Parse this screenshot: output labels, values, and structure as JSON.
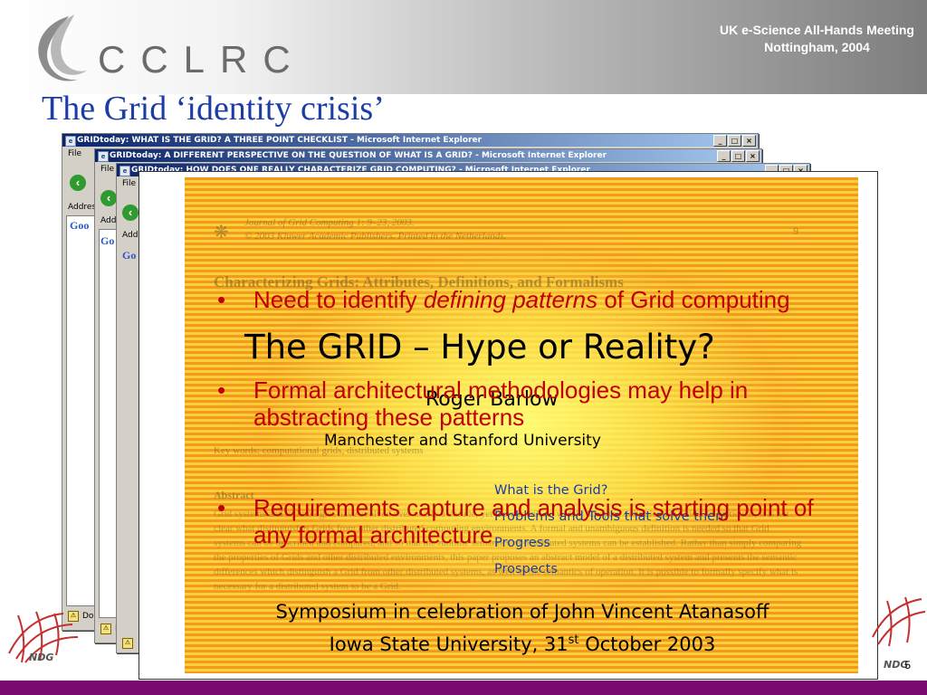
{
  "header": {
    "logo_text": "CCLRC",
    "meeting_line1": "UK e-Science All-Hands Meeting",
    "meeting_line2": "Nottingham, 2004"
  },
  "slide": {
    "title": "The Grid ‘identity crisis’",
    "page_number": "5"
  },
  "ie_windows": [
    {
      "title": "GRIDtoday: WHAT IS THE GRID? A THREE POINT CHECKLIST - Microsoft Internet Explorer",
      "menu": "File",
      "addr": "Address",
      "google": "Goo",
      "status": "Do"
    },
    {
      "title": "GRIDtoday: A DIFFERENT PERSPECTIVE ON THE QUESTION OF WHAT IS A GRID? - Microsoft Internet Explorer",
      "menu": "File",
      "addr": "Address",
      "google": "Go",
      "status": "D"
    },
    {
      "title": "GRIDtoday: HOW DOES ONE REALLY CHARACTERIZE GRID COMPUTING? - Microsoft Internet Explorer",
      "menu": "File",
      "addr": "Address",
      "google": "Go",
      "status": ""
    }
  ],
  "window_buttons": [
    "_",
    "□",
    "×"
  ],
  "paper": {
    "journal": "Journal of Grid Computing 1: 9–23, 2003.",
    "copyright": "© 2003 Kluwer Academic Publishers.  Printed in the Netherlands.",
    "page": "9",
    "heading": "Characterizing Grids: Attributes, Definitions, and Formalisms",
    "abstract_label": "Abstract",
    "keywords": "Key words: computational grids, distributed systems",
    "body": "Grid systems and technologies have evolved over nearly a decade, yet there is still no widely accepted definition for Grids. In particular, it is not clear what distinguishes Grids from other distributed computing environments. A formal and unambiguous definition is needed so that Grid systems can be described and compared, and so that the runtime semantics of distributed systems can be established. Rather than simply comparing the properties of Grids and other distributed environments, this paper proposes an abstract model of a distributed system and presents the semantic differences which distinguish a Grid from other distributed systems, as well as the semantics of operation. It is possible to formally specify what is necessary for a distributed system to be a Grid."
  },
  "talk": {
    "title": "The GRID – Hype or Reality?",
    "author": "Roger Barlow",
    "affiliation": "Manchester and Stanford University",
    "outline": [
      "What is the Grid?",
      "Problems and Tools that solve them",
      "Progress",
      "Prospects"
    ],
    "symposium_line1": "Symposium in celebration of John Vincent Atanasoff",
    "symposium_line2_prefix": "Iowa State University, 31",
    "symposium_sup": "st",
    "symposium_line2_suffix": " October 2003"
  },
  "bullets": [
    {
      "prefix": "Need to identify ",
      "emphasis": "defining patterns",
      "suffix": " of Grid computing"
    },
    {
      "text": "Formal architectural methodologies may help in abstracting these patterns"
    },
    {
      "text": "Requirements capture and analysis is starting point of any formal architecture"
    }
  ],
  "ndg_label": "NDG",
  "colors": {
    "title_blue": "#1c3ca6",
    "bullet_red": "#c00000",
    "bottom_bar": "#7a0a6e"
  }
}
